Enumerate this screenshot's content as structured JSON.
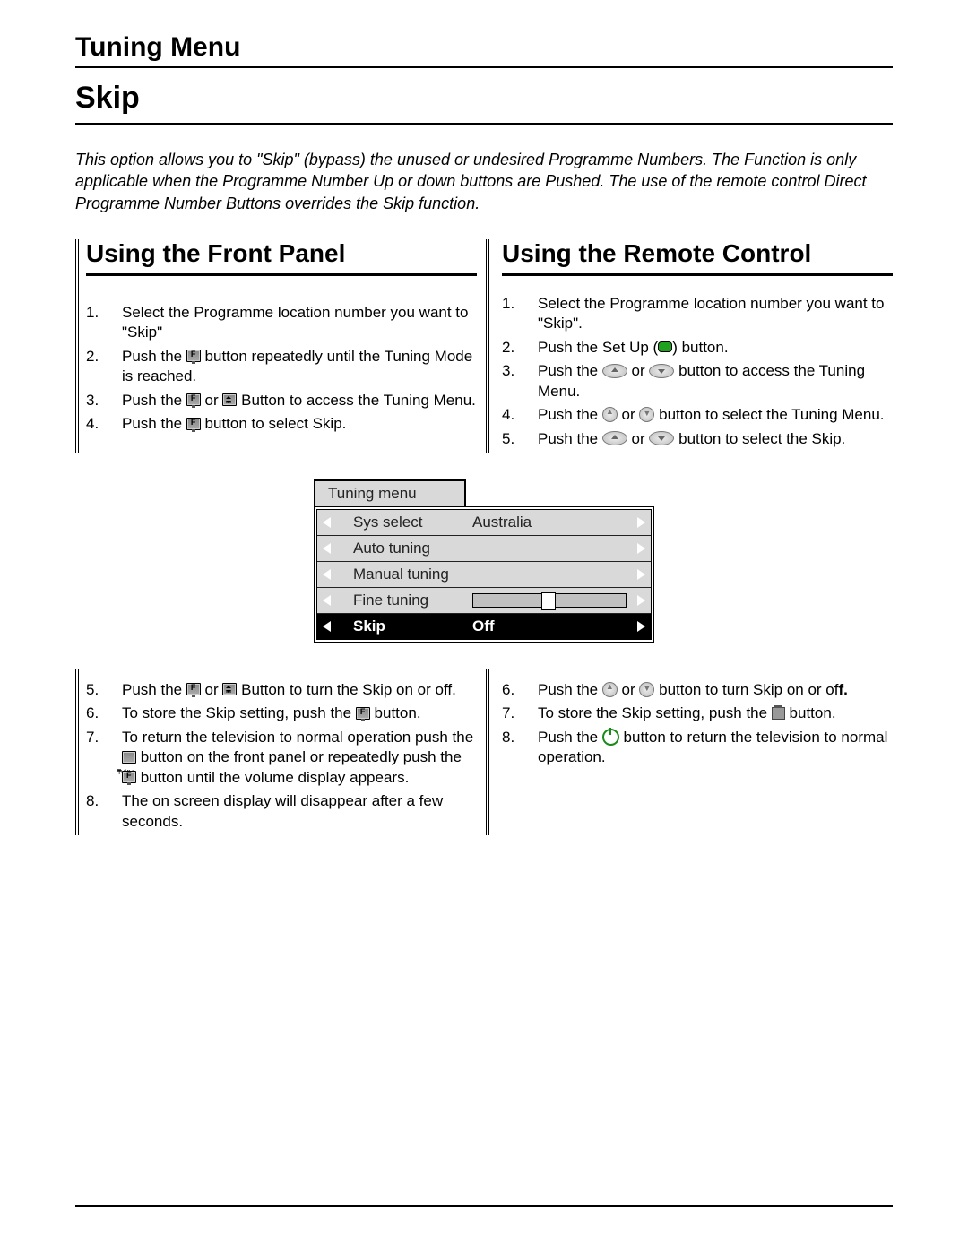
{
  "header": {
    "section": "Tuning Menu",
    "title": "Skip"
  },
  "intro": "This option allows you to \"Skip\" (bypass) the unused or undesired Programme Numbers. The Function is only applicable when the Programme Number Up or down buttons are Pushed. The use of the remote control Direct Programme Number Buttons overrides the Skip function.",
  "left": {
    "heading": "Using the Front Panel",
    "stepsA": [
      {
        "n": "1.",
        "pre": "Select the Programme location number you want to \"Skip\""
      },
      {
        "n": "2.",
        "pre": "Push the ",
        "icon": "f-button-icon",
        "post": " button repeatedly until the Tuning Mode is reached."
      },
      {
        "n": "3.",
        "pre": "Push the ",
        "icon": "f-button-icon",
        "mid": " or ",
        "icon2": "updown-button-icon",
        "post": " Button to access the Tuning Menu."
      },
      {
        "n": "4.",
        "pre": "Push the ",
        "icon": "f-button-icon",
        "post": " button to select Skip."
      }
    ],
    "stepsB": [
      {
        "n": "5.",
        "pre": "Push the ",
        "icon": "f-button-icon",
        "mid": " or ",
        "icon2": "updown-button-icon",
        "post": " Button to turn the Skip on or off."
      },
      {
        "n": "6.",
        "pre": "To store the Skip setting, push the ",
        "icon": "f-button-icon",
        "post": " button."
      },
      {
        "n": "7.",
        "pre": "To return the television to normal operation push the ",
        "icon": "tvav-button-icon",
        "mid": " button on the front panel or repeatedly push the ",
        "icon2": "f-button-icon",
        "post": " button until the volume display appears."
      },
      {
        "n": "8.",
        "pre": "The on screen display will disappear after a few seconds."
      }
    ]
  },
  "right": {
    "heading": "Using the Remote Control",
    "stepsA": [
      {
        "n": "1.",
        "pre": "Select the Programme location number you want to \"Skip\"."
      },
      {
        "n": "2.",
        "pre": "Push the Set Up (",
        "icon": "setup-green-icon",
        "post": ") button."
      },
      {
        "n": "3.",
        "pre": "Push the ",
        "icon": "oval-up-icon",
        "mid": " or ",
        "icon2": "oval-down-icon",
        "post": " button to access the Tuning Menu."
      },
      {
        "n": "4.",
        "pre": "Push the ",
        "icon": "round-up-icon",
        "mid": " or ",
        "icon2": "round-down-icon",
        "post": " button to select the Tuning Menu."
      },
      {
        "n": "5.",
        "pre": "Push the ",
        "icon": "oval-up-icon",
        "mid": " or ",
        "icon2": "oval-down-icon",
        "post": " button to select the Skip."
      }
    ],
    "stepsB": [
      {
        "n": "6.",
        "pre": "Push the ",
        "icon": "round-up-icon",
        "mid": " or ",
        "icon2": "round-down-icon",
        "post": " button to turn Skip on or of",
        "bold": "f."
      },
      {
        "n": "7.",
        "pre": "To store the Skip setting, push the ",
        "icon": "memory-button-icon",
        "post": " button."
      },
      {
        "n": "8.",
        "pre": "Push the ",
        "icon": "power-button-icon",
        "post": " button to return the television to normal operation."
      }
    ]
  },
  "osd": {
    "header": "Tuning menu",
    "rows": [
      {
        "label": "Sys select",
        "value": "Australia"
      },
      {
        "label": "Auto tuning"
      },
      {
        "label": "Manual tuning"
      },
      {
        "label": "Fine tuning",
        "bar": true
      },
      {
        "label": "Skip",
        "value": "Off",
        "selected": true
      }
    ]
  }
}
